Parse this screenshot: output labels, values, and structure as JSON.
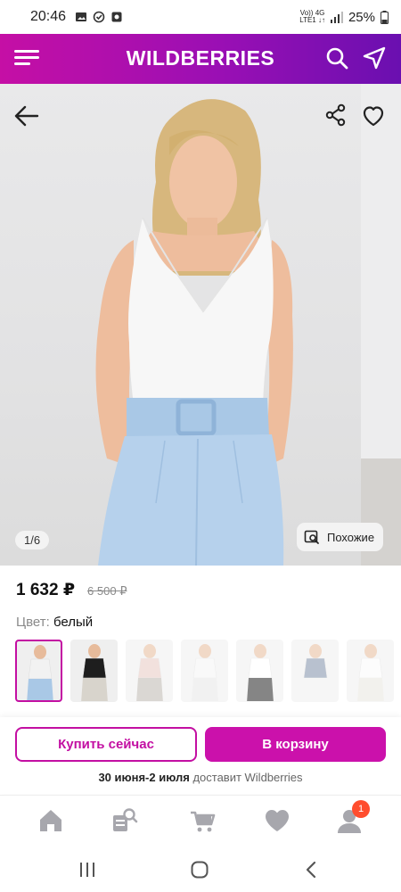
{
  "status_bar": {
    "time": "20:46",
    "network_top": "Vo)) 4G",
    "network_bottom": "LTE1 ↓↑",
    "battery": "25%"
  },
  "header": {
    "brand": "WILDBERRIES",
    "gradient_colors": [
      "#c50fa5",
      "#6a0fb0"
    ]
  },
  "photo": {
    "counter": "1/6",
    "similar_label": "Похожие"
  },
  "product": {
    "price": "1 632 ₽",
    "old_price": "6 500 ₽",
    "color_label": "Цвет:",
    "color_value": "белый"
  },
  "thumbnails": [
    {
      "top_color": "#f2f2f2",
      "bottom_color": "#a9c8e6",
      "active": true
    },
    {
      "top_color": "#1e1e1e",
      "bottom_color": "#d8d4cc",
      "active": false
    },
    {
      "top_color": "#e8c9c3",
      "bottom_color": "#bdb7b0",
      "active": false
    },
    {
      "top_color": "#f5f5f5",
      "bottom_color": "#e6e6e6",
      "active": false
    },
    {
      "top_color": "#ffffff",
      "bottom_color": "#222222",
      "active": false
    },
    {
      "top_color": "#7f8fa8",
      "bottom_color": "#efefef",
      "active": false
    },
    {
      "top_color": "#fafafa",
      "bottom_color": "#e9e6e0",
      "active": false
    }
  ],
  "actions": {
    "buy_now": "Купить сейчас",
    "add_to_cart": "В корзину",
    "delivery_dates": "30 июня-2 июля",
    "delivery_text": " доставит Wildberries"
  },
  "bottom_nav": {
    "items": [
      "home-icon",
      "catalog-search-icon",
      "cart-icon",
      "favorites-icon",
      "profile-icon"
    ],
    "profile_badge": "1"
  },
  "colors": {
    "accent": "#cb11ab",
    "accent_border": "#c30fa2",
    "badge": "#ff4d2e"
  }
}
